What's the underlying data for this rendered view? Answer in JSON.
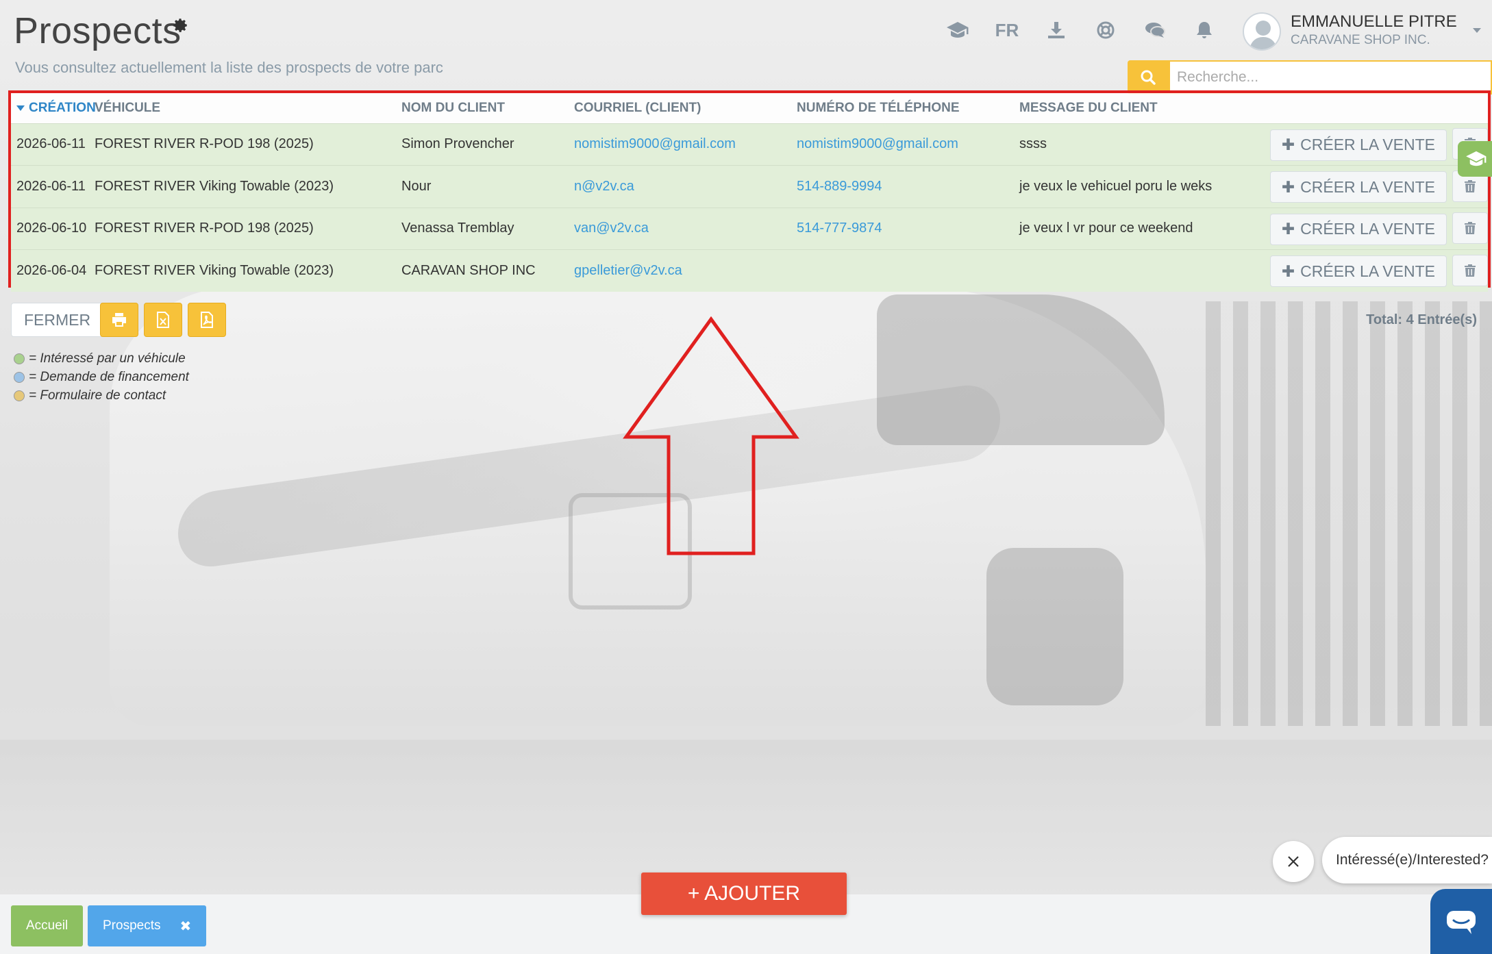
{
  "header": {
    "title": "Prospects",
    "subtitle": "Vous consultez actuellement la liste des prospects de votre parc",
    "language": "FR",
    "user_name": "EMMANUELLE PITRE",
    "user_org": "CARAVANE SHOP INC."
  },
  "search": {
    "placeholder": "Recherche..."
  },
  "table": {
    "columns": [
      "CRÉATION",
      "VÉHICULE",
      "NOM DU CLIENT",
      "COURRIEL (CLIENT)",
      "NUMÉRO DE TÉLÉPHONE",
      "MESSAGE DU CLIENT"
    ],
    "create_label": "CRÉER LA VENTE",
    "rows": [
      {
        "date": "2026-06-11",
        "vehicle": "FOREST RIVER R-POD 198 (2025)",
        "client": "Simon Provencher",
        "email": "nomistim9000@gmail.com",
        "phone": "nomistim9000@gmail.com",
        "message": "ssss"
      },
      {
        "date": "2026-06-11",
        "vehicle": "FOREST RIVER Viking Towable (2023)",
        "client": "Nour",
        "email": "n@v2v.ca",
        "phone": "514-889-9994",
        "message": "je veux le vehicuel poru le weks"
      },
      {
        "date": "2026-06-10",
        "vehicle": "FOREST RIVER R-POD 198 (2025)",
        "client": "Venassa Tremblay",
        "email": "van@v2v.ca",
        "phone": "514-777-9874",
        "message": "je veux l vr pour ce weekend"
      },
      {
        "date": "2026-06-04",
        "vehicle": "FOREST RIVER Viking Towable (2023)",
        "client": "CARAVAN SHOP INC",
        "email": "gpelletier@v2v.ca",
        "phone": "",
        "message": ""
      }
    ],
    "row_color": "#e2efd9"
  },
  "toolbar": {
    "close_label": "FERMER",
    "total_label": "Total: 4 Entrée(s)"
  },
  "legend": [
    {
      "text": "= Intéressé par un véhicule",
      "color": "#a9d18e"
    },
    {
      "text": "= Demande de financement",
      "color": "#9dc3e6"
    },
    {
      "text": "= Formulaire de contact",
      "color": "#e6c87a"
    }
  ],
  "bottom": {
    "add_label": "+ AJOUTER",
    "tabs": [
      "Accueil",
      "Prospects"
    ],
    "chat_prompt": "Intéressé(e)/Interested?"
  },
  "colors": {
    "accent_yellow": "#f7c23a",
    "add_red": "#e8503a",
    "highlight_red": "#e0201f",
    "tab_green": "#8dc061",
    "tab_blue": "#52a6ea",
    "chat_blue": "#1f5fa6"
  }
}
